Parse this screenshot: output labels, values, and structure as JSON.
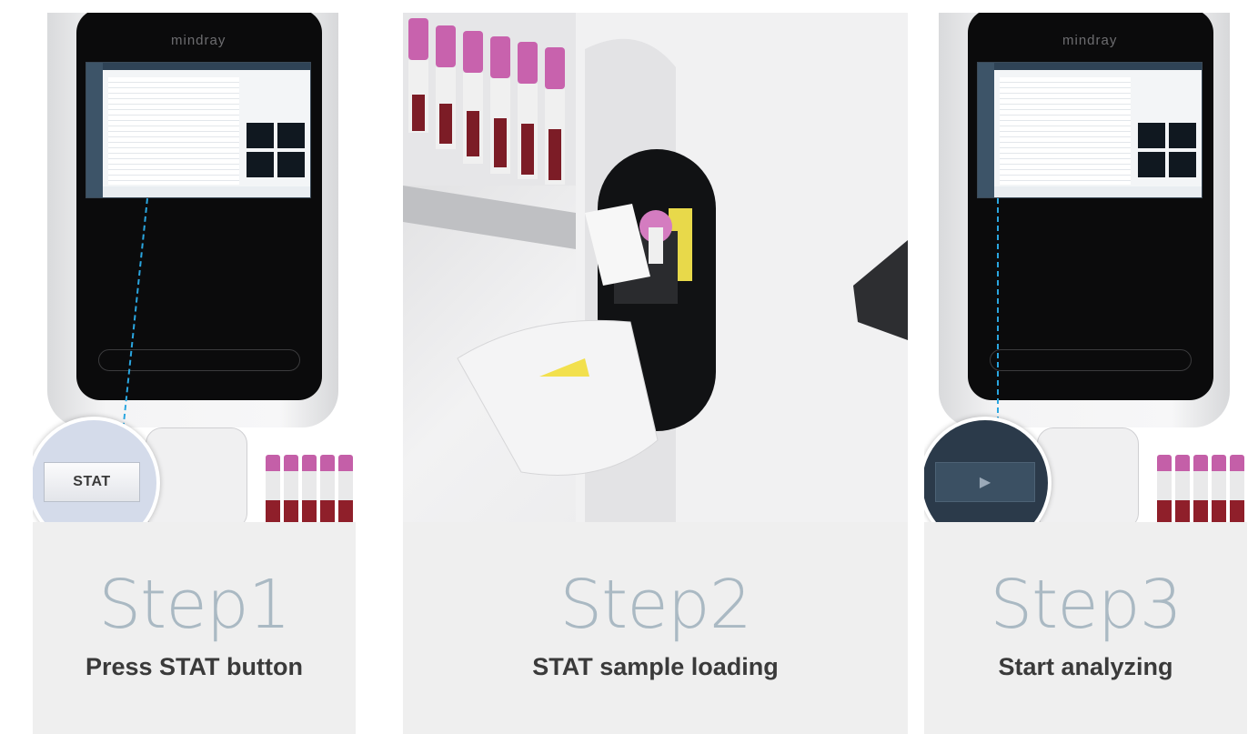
{
  "device": {
    "brand": "mindray"
  },
  "steps": [
    {
      "title": "Step1",
      "description": "Press STAT button",
      "zoom_button_label": "STAT"
    },
    {
      "title": "Step2",
      "description": "STAT sample loading"
    },
    {
      "title": "Step3",
      "description": "Start analyzing",
      "zoom_button_icon": "play-icon",
      "zoom_button_glyph": "▶"
    }
  ],
  "colors": {
    "step_title": "#aab9c3",
    "step_description": "#3a3a3a",
    "caption_background": "#efefef",
    "highlight_line": "#2aa6e0",
    "zoom_circle_step1": "#d4dbea",
    "zoom_circle_step3": "#2b3a4a"
  }
}
